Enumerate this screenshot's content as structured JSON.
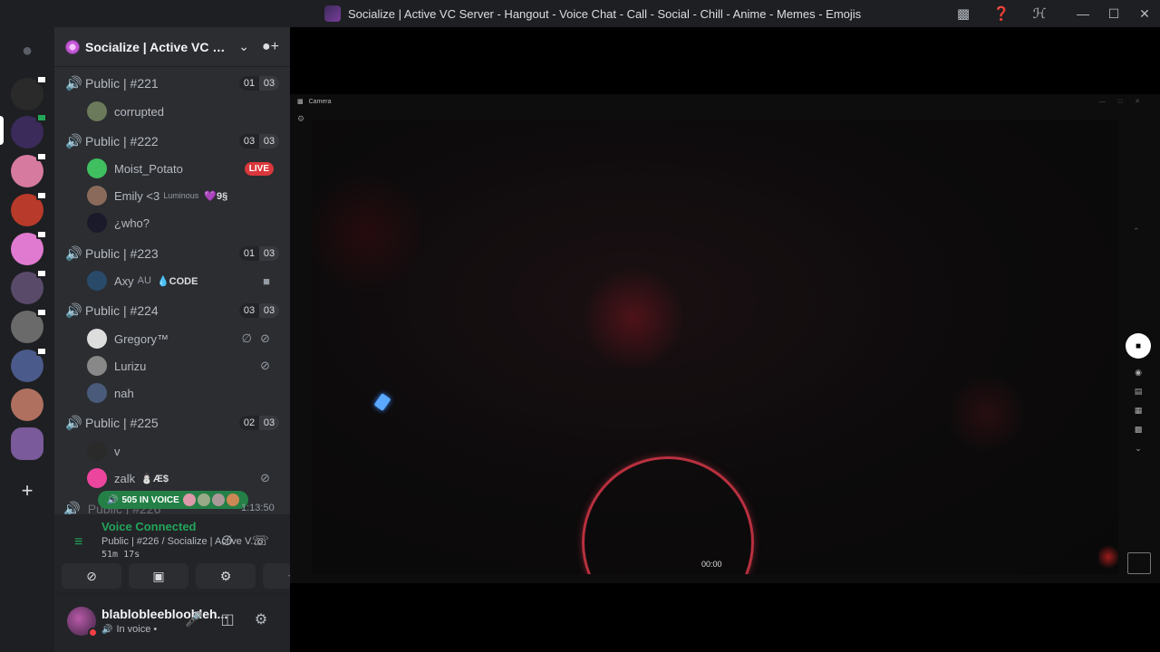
{
  "window": {
    "title": "Socialize | Active VC Server - Hangout - Voice Chat - Call - Social - Chill - Anime - Memes - Emojis",
    "icons": [
      "inbox-icon",
      "help-icon",
      "sleep-icon"
    ],
    "controls": {
      "minimize": "—",
      "maximize": "☐",
      "close": "✕"
    }
  },
  "rail": {
    "servers": [
      {
        "name": "server-1",
        "color": "#2a2a2a"
      },
      {
        "name": "server-socialize",
        "color": "#3a2b5a",
        "active": true
      },
      {
        "name": "server-3",
        "color": "#d67aa0"
      },
      {
        "name": "server-4",
        "color": "#b83a2a"
      },
      {
        "name": "server-5",
        "color": "#e07ad0"
      },
      {
        "name": "server-6",
        "color": "#5a4a6a"
      },
      {
        "name": "server-7",
        "color": "#6a6a6a"
      },
      {
        "name": "server-8",
        "color": "#4a5a8a"
      },
      {
        "name": "server-9",
        "color": "#b07060"
      },
      {
        "name": "server-10",
        "color": "#7a5a9a"
      }
    ],
    "add_icon": "+"
  },
  "guild": {
    "name": "Socialize | Active VC S...",
    "chevron": "⌄",
    "invite_icon": "⚒"
  },
  "channels": [
    {
      "name": "Public | #221",
      "count_a": "01",
      "count_b": "03"
    },
    {
      "name": "Public | #222",
      "count_a": "03",
      "count_b": "03"
    },
    {
      "name": "Public | #223",
      "count_a": "01",
      "count_b": "03"
    },
    {
      "name": "Public | #224",
      "count_a": "03",
      "count_b": "03"
    },
    {
      "name": "Public | #225",
      "count_a": "02",
      "count_b": "03"
    }
  ],
  "members": [
    {
      "name": "corrupted"
    },
    {
      "name": "Moist_Potato",
      "live": "LIVE"
    },
    {
      "name": "Emily <3",
      "tag": "Luminous",
      "extra": "💜9§"
    },
    {
      "name": "¿who?"
    },
    {
      "name": "Axy",
      "tag": "AU",
      "extra": "💧CODE",
      "right": "■"
    },
    {
      "name": "Gregory™",
      "right": "∅",
      "right2": "⊘"
    },
    {
      "name": "Lurizu",
      "right": "⊘"
    },
    {
      "name": "nah"
    },
    {
      "name": "v"
    },
    {
      "name": "zalk",
      "extra": "⛄Æ$",
      "right": "⊘"
    }
  ],
  "hidden_channel": "Public | #226",
  "in_voice": {
    "label": "505 IN VOICE",
    "time": "1:13:50"
  },
  "voice": {
    "status": "Voice Connected",
    "channel": "Public | #226 / Socialize | Active V...",
    "duration": "51m 17s",
    "buttons": [
      "camera-off",
      "screen-share",
      "activities",
      "soundboard"
    ]
  },
  "user": {
    "name": "blablobleebloobleh...",
    "status": "In voice •"
  },
  "camera": {
    "title": "Camera",
    "timestamp": "00:00"
  }
}
